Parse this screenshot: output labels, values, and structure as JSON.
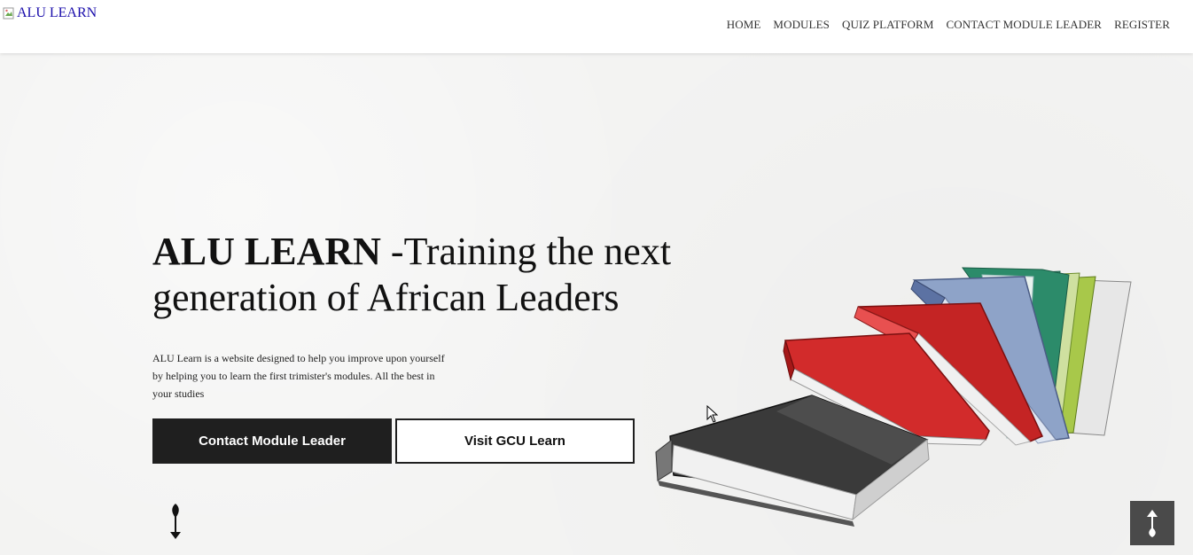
{
  "header": {
    "logo_alt": "ALU LEARN",
    "nav": [
      {
        "label": "HOME"
      },
      {
        "label": "MODULES"
      },
      {
        "label": "QUIZ PLATFORM"
      },
      {
        "label": "CONTACT MODULE LEADER"
      },
      {
        "label": "REGISTER"
      }
    ]
  },
  "hero": {
    "title_bold": "ALU LEARN",
    "title_rest": " -Training the next generation of African Leaders",
    "description": "ALU Learn is a website designed to help you improve upon yourself by helping you to learn the first trimister's modules. All the best in your studies",
    "primary_button": "Contact Module Leader",
    "secondary_button": "Visit GCU Learn"
  },
  "icons": {
    "scroll_down": "arrow-down-icon",
    "back_to_top": "arrow-up-icon",
    "books_illustration": "books-icon"
  },
  "colors": {
    "header_bg": "#ffffff",
    "hero_bg": "#f3f3f2",
    "primary_button_bg": "#1f1f1f",
    "logo_link": "#1a0dab",
    "back_to_top_bg": "#4a4a4a"
  }
}
